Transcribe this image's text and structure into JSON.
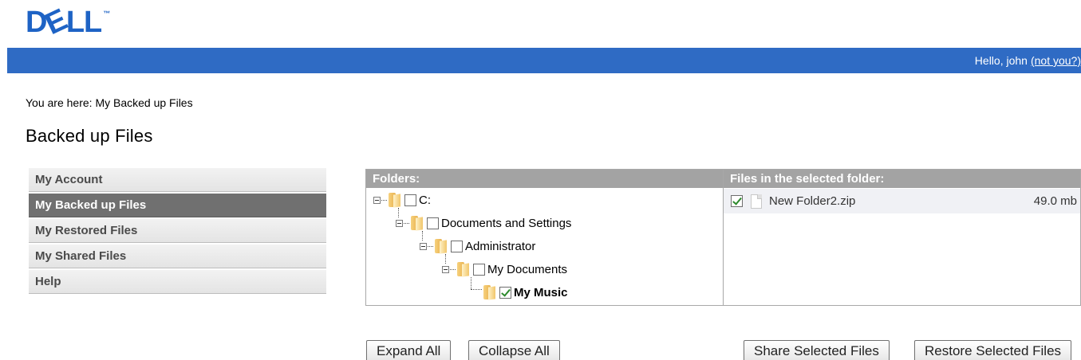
{
  "brand": {
    "logo_text": "D",
    "logo_e": "E",
    "logo_rest": "LL",
    "trademark": "™",
    "color": "#1e63c5"
  },
  "topbar": {
    "greeting": "Hello, john",
    "not_you_link": "(not you?)"
  },
  "breadcrumb": "You are here: My Backed up Files",
  "page_title": "Backed up Files",
  "sidebar": {
    "items": [
      {
        "label": "My Account",
        "active": false
      },
      {
        "label": "My Backed up Files",
        "active": true
      },
      {
        "label": "My Restored Files",
        "active": false
      },
      {
        "label": "My Shared Files",
        "active": false
      },
      {
        "label": "Help",
        "active": false
      }
    ]
  },
  "folders": {
    "header": "Folders:",
    "tree": [
      {
        "label": "C:",
        "checked": false
      },
      {
        "label": "Documents and Settings",
        "checked": false
      },
      {
        "label": "Administrator",
        "checked": false
      },
      {
        "label": "My Documents",
        "checked": false
      },
      {
        "label": "My Music",
        "checked": true,
        "bold": true
      }
    ]
  },
  "files": {
    "header": "Files in the selected folder:",
    "rows": [
      {
        "name": "New Folder2.zip",
        "size": "49.0 mb",
        "checked": true
      }
    ]
  },
  "buttons": {
    "expand_all": "Expand All",
    "collapse_all": "Collapse All",
    "share_selected": "Share Selected Files",
    "restore_selected": "Restore Selected Files"
  },
  "colors": {
    "topbar": "#2f6bc4",
    "panel_header": "#a3a3a3",
    "active_nav": "#707070"
  }
}
